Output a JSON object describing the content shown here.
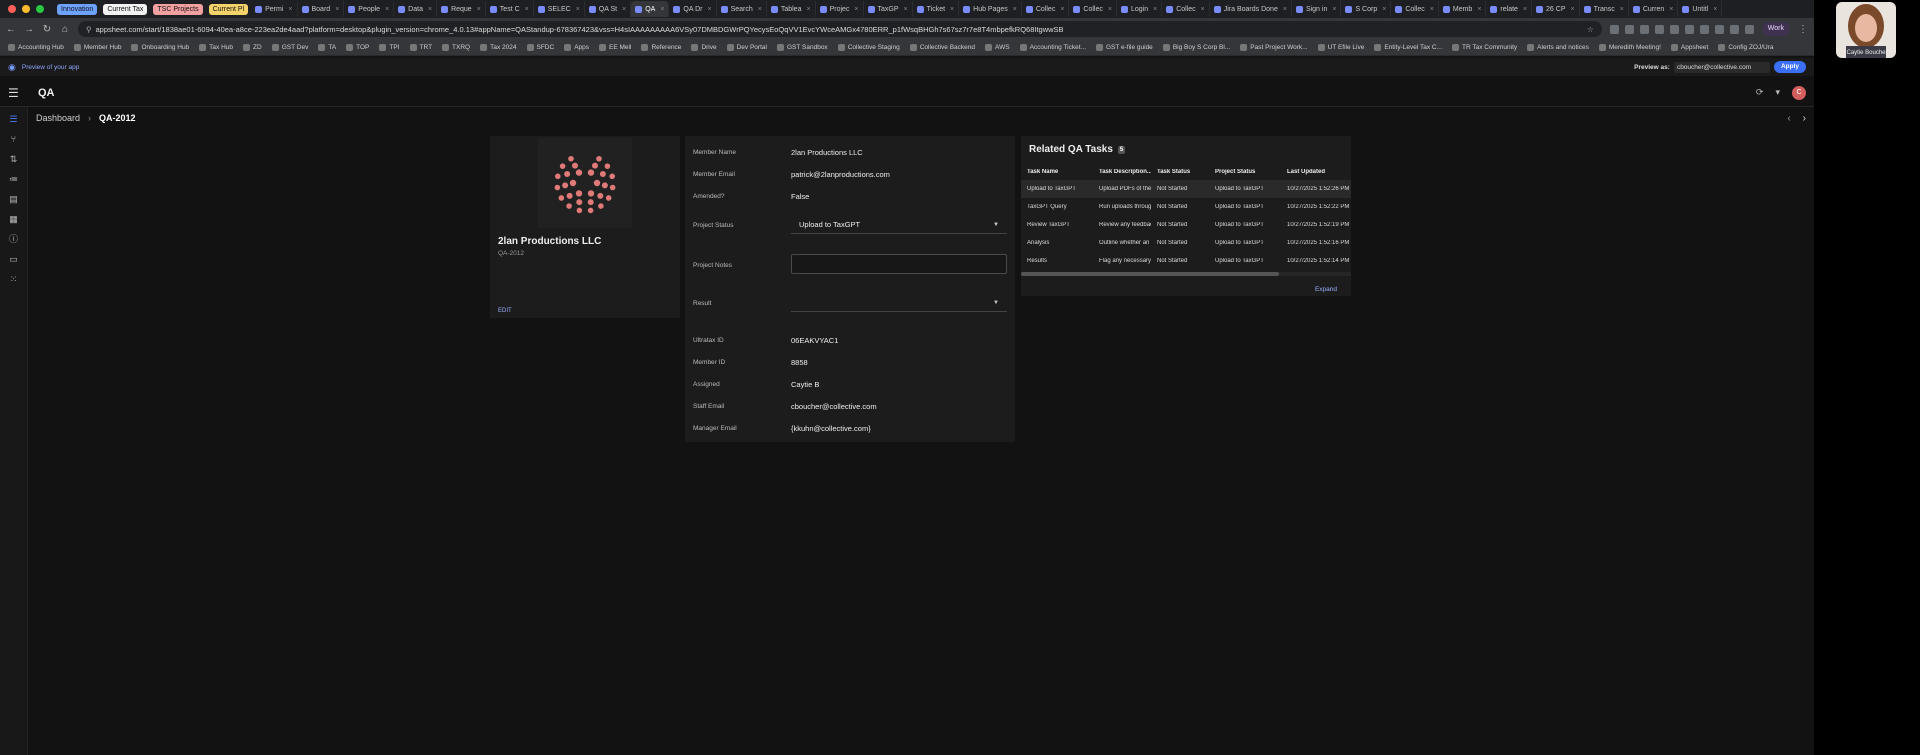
{
  "browser": {
    "tab_groups": [
      {
        "label": "Innovation",
        "color": "#6ea2ff"
      },
      {
        "label": "Current Tax",
        "color": "#f2f2f2"
      },
      {
        "label": "TSC Projects",
        "color": "#f2a0a0"
      },
      {
        "label": "Current Pl",
        "color": "#f5d36b"
      }
    ],
    "tabs": [
      "Permi",
      "Board",
      "People",
      "Data",
      "Reque",
      "Test C",
      "SELEC",
      "QA St",
      "QA",
      "QA Dr",
      "Search",
      "Tablea",
      "Projec",
      "TaxGP",
      "Ticket",
      "Hub Pages",
      "Collec",
      "Collec",
      "Login",
      "Collec",
      "Jira Boards Done",
      "Sign in",
      "S Corp",
      "Collec",
      "Memb",
      "relate",
      "26 CP",
      "Transc",
      "Curren",
      "Untitl"
    ],
    "active_tab": "QA",
    "url": "appsheet.com/start/1838ae01-6094-40ea-a8ce-223ea2de4aad?platform=desktop&plugin_version=chrome_4.0.13#appName=QAStandup-678367423&vss=H4sIAAAAAAAAA6VSy07DMBDGWrPQYecysEoQqVV1EvcYWceAMGx4780ERR_p1fWsqBHGh7s67sz7r7e8T4mbpefkRQ68ItgwwSB",
    "work_label": "Work",
    "bookmarks": [
      "Accounting Hub",
      "Member Hub",
      "Onboarding Hub",
      "Tax Hub",
      "ZD",
      "GST Dev",
      "TA",
      "TOP",
      "TPI",
      "TRT",
      "TXRQ",
      "Tax 2024",
      "SFDC",
      "Apps",
      "EE Mell",
      "Reference",
      "Drive",
      "Dev Portal",
      "GST Sandbox",
      "Collective Staging",
      "Collective Backend",
      "AWS",
      "Accounting Ticket...",
      "GST e-file guide",
      "Big Boy S Corp Bl...",
      "Past Project Work...",
      "UT Efile Live",
      "Entity-Level Tax C...",
      "TR Tax Community",
      "Alerts and notices",
      "Meredith Meeting!",
      "Appsheet",
      "Config ZOJ/Ura"
    ]
  },
  "preview": {
    "text": "Preview of your app",
    "preview_as_label": "Preview as:",
    "preview_as_value": "cboucher@collective.com",
    "apply_label": "Apply"
  },
  "app": {
    "title": "QA",
    "avatar_letter": "C"
  },
  "breadcrumb": {
    "root": "Dashboard",
    "current": "QA-2012"
  },
  "member_card": {
    "name": "2lan Productions LLC",
    "id": "QA-2012",
    "edit_label": "EDIT"
  },
  "details": {
    "member_name": {
      "label": "Member Name",
      "value": "2lan Productions LLC"
    },
    "member_email": {
      "label": "Member Email",
      "value": "patrick@2lanproductions.com"
    },
    "amended": {
      "label": "Amended?",
      "value": "False"
    },
    "project_status": {
      "label": "Project Status",
      "value": "Upload to TaxGPT"
    },
    "project_notes": {
      "label": "Project Notes",
      "value": ""
    },
    "result": {
      "label": "Result",
      "value": ""
    },
    "ultratax_id": {
      "label": "Ultratax ID",
      "value": "06EAKVYAC1"
    },
    "member_id": {
      "label": "Member ID",
      "value": "8858"
    },
    "assigned": {
      "label": "Assigned",
      "value": "Caytie B"
    },
    "staff_email": {
      "label": "Staff Email",
      "value": "cboucher@collective.com"
    },
    "manager_email": {
      "label": "Manager Email",
      "value": "{kkuhn@collective.com}"
    }
  },
  "related": {
    "title": "Related QA Tasks",
    "count": "5",
    "columns": [
      "Task Name",
      "Task Description...",
      "Task Status",
      "Project Status",
      "Last Updated"
    ],
    "rows": [
      [
        "Upload to TaxGPT",
        "Upload PDFs of the",
        "Not Started",
        "Upload to TaxGPT",
        "10/27/2025 1:52:26 PM"
      ],
      [
        "TaxGPT Query",
        "Run uploads throug",
        "Not Started",
        "Upload to TaxGPT",
        "10/27/2025 1:52:22 PM"
      ],
      [
        "Review TaxGPT",
        "Review any feedbac",
        "Not Started",
        "Upload to TaxGPT",
        "10/27/2025 1:52:19 PM"
      ],
      [
        "Analysis",
        "Outline whether an",
        "Not Started",
        "Upload to TaxGPT",
        "10/27/2025 1:52:16 PM"
      ],
      [
        "Results",
        "Flag any necessary",
        "Not Started",
        "Upload to TaxGPT",
        "10/27/2025 1:52:14 PM"
      ]
    ],
    "expand_label": "Expand"
  },
  "webcam": {
    "name": "Caytie Boucher"
  },
  "colors": {
    "accent": "#3b6ff5",
    "logo": "#e07a78"
  }
}
